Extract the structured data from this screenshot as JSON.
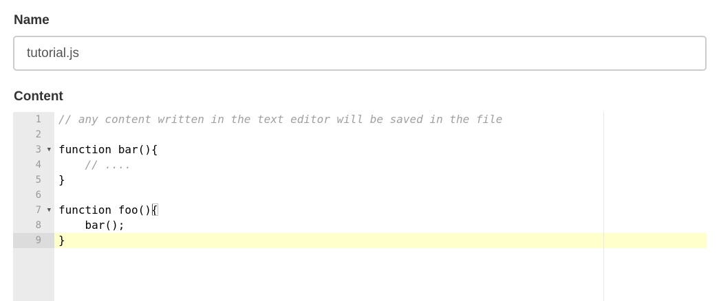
{
  "form": {
    "name_label": "Name",
    "name_value": "tutorial.js",
    "content_label": "Content"
  },
  "editor": {
    "lines": [
      {
        "number": "1",
        "text": "// any content written in the text editor will be saved in the file",
        "comment": true,
        "fold": false
      },
      {
        "number": "2",
        "text": "",
        "comment": false,
        "fold": false
      },
      {
        "number": "3",
        "text": "function bar(){",
        "comment": false,
        "fold": true
      },
      {
        "number": "4",
        "text": "    // ....",
        "comment": true,
        "fold": false
      },
      {
        "number": "5",
        "text": "}",
        "comment": false,
        "fold": false
      },
      {
        "number": "6",
        "text": "",
        "comment": false,
        "fold": false
      },
      {
        "number": "7",
        "text": "function foo(){",
        "comment": false,
        "fold": true
      },
      {
        "number": "8",
        "text": "    bar();",
        "comment": false,
        "fold": false
      },
      {
        "number": "9",
        "text": "}",
        "comment": false,
        "fold": false
      }
    ],
    "active_line": 9,
    "fold_icon": "triangle-down-icon",
    "colors": {
      "gutter_bg": "#ebebeb",
      "active_line_bg": "#ffffcc",
      "comment": "#a0a0a0"
    }
  }
}
